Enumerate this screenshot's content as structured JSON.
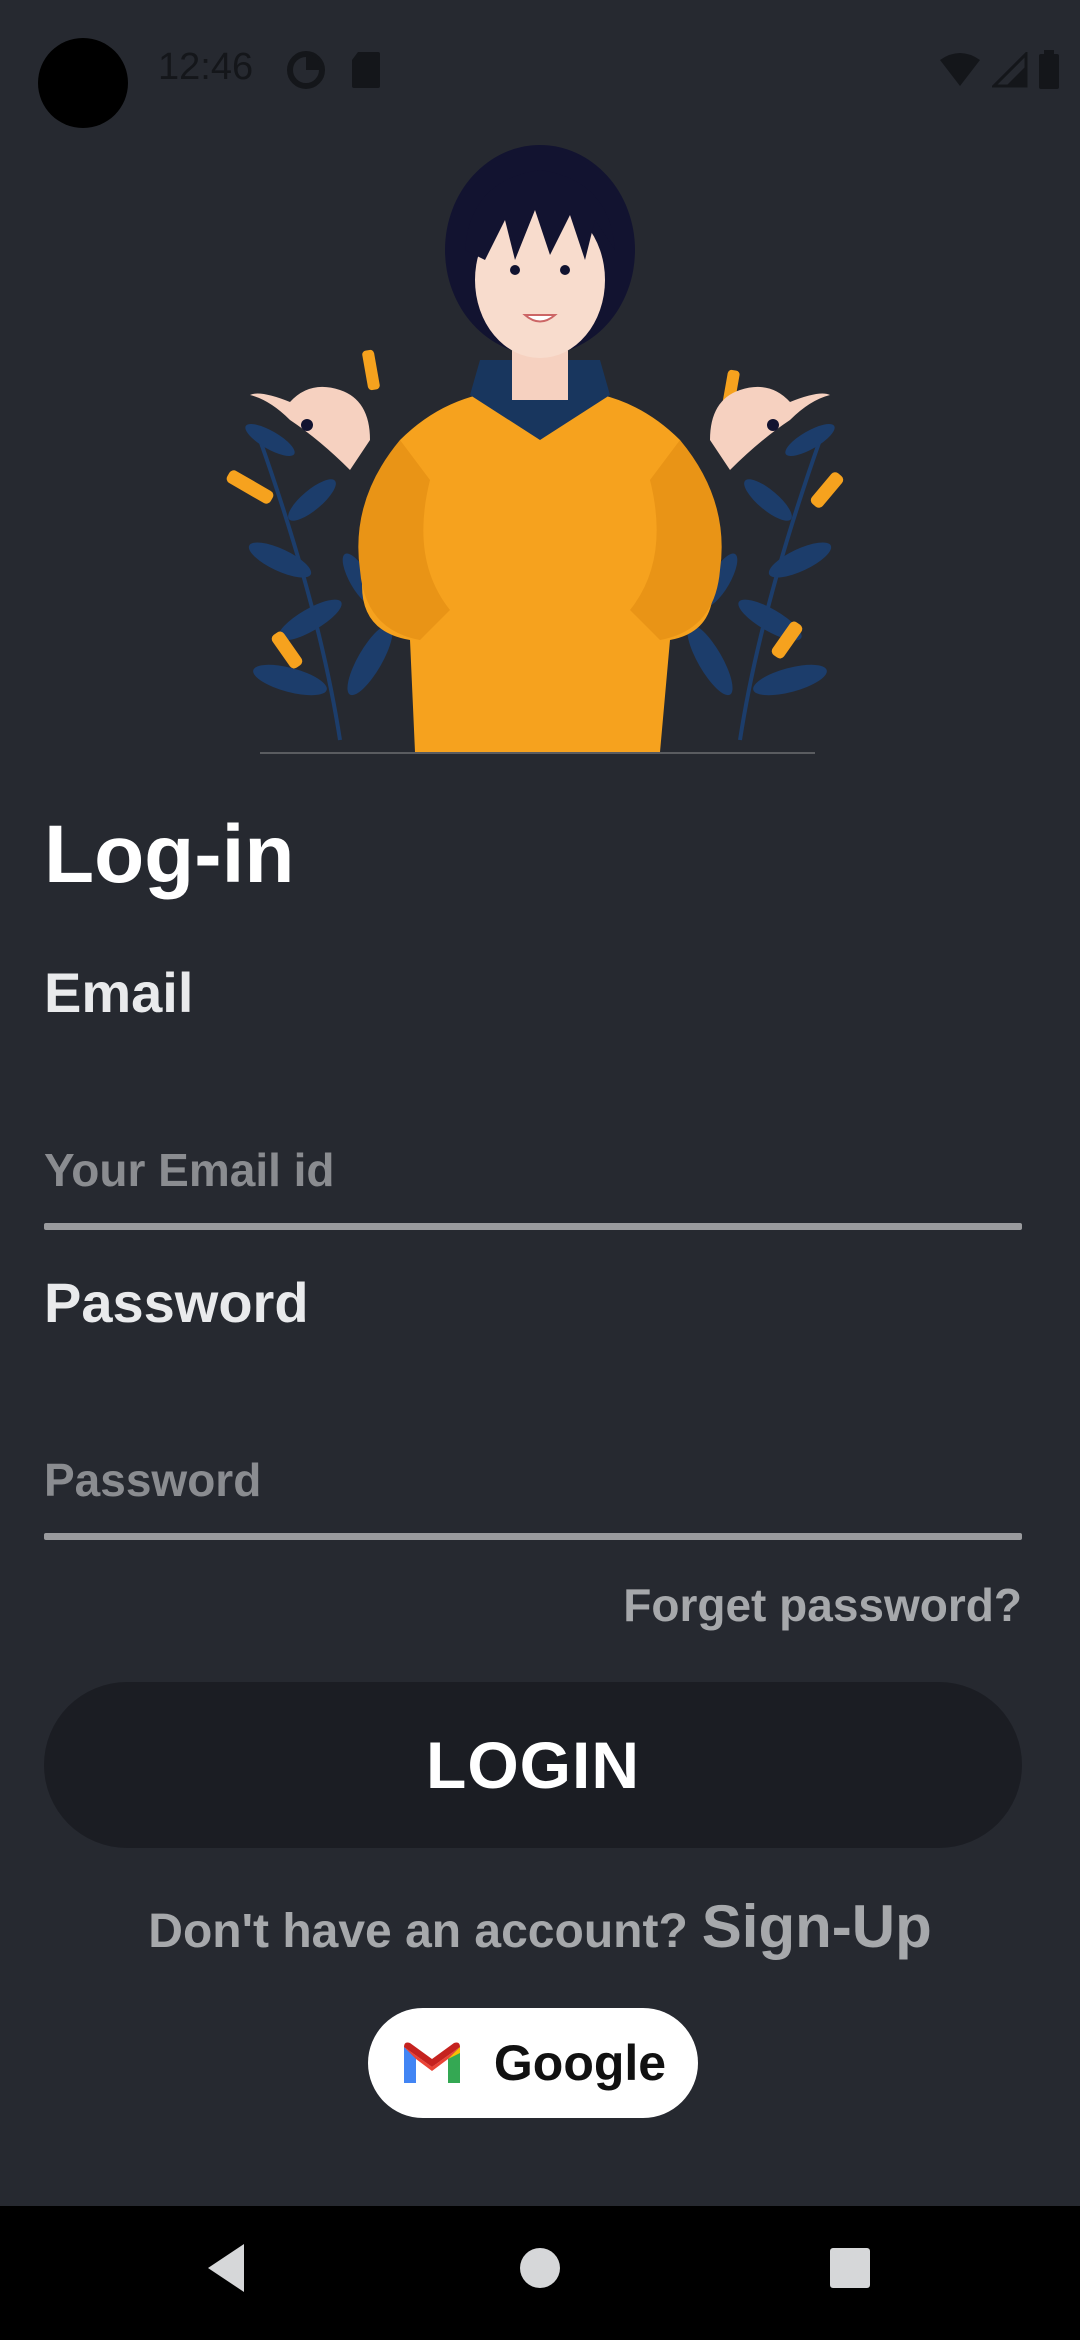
{
  "status_bar": {
    "time": "12:46",
    "icons_left": [
      "data-saver-icon",
      "sd-card-icon"
    ],
    "icons_right": [
      "wifi-icon",
      "cell-signal-icon",
      "battery-icon"
    ]
  },
  "illustration": {
    "icon": "woman-shrugging-illustration",
    "colors": {
      "sweater": "#f6a21e",
      "hair": "#121330",
      "collar": "#18365e",
      "leaves": "#1c3d6b"
    }
  },
  "form": {
    "title": "Log-in",
    "email_label": "Email",
    "email_placeholder": "Your Email id",
    "email_value": "",
    "password_label": "Password",
    "password_placeholder": "Password",
    "password_value": "",
    "forgot_password": "Forget password?",
    "login_button": "LOGIN",
    "signup_prompt": "Don't have an account?",
    "signup_link": "Sign-Up",
    "google_button": "Google"
  },
  "nav_bar": {
    "buttons": [
      "back-icon",
      "home-icon",
      "recents-icon"
    ]
  },
  "colors": {
    "background": "#262930",
    "button": "#1b1d23",
    "muted_text": "#a6a8ab"
  }
}
